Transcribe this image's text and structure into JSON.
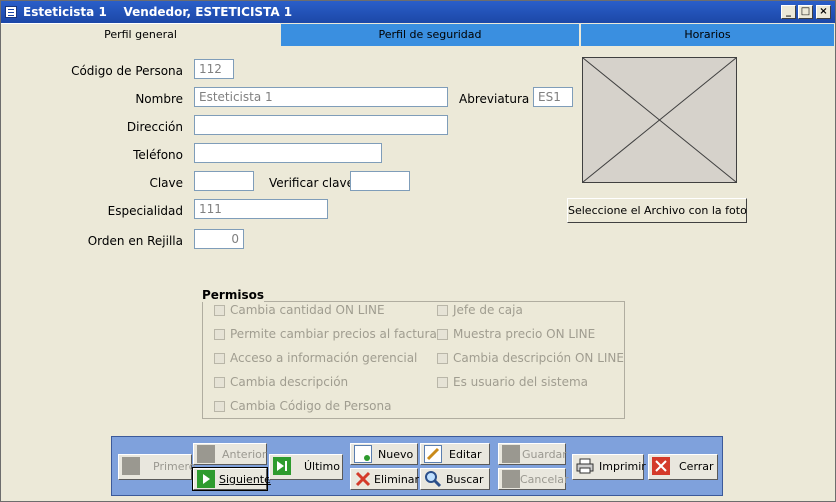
{
  "window": {
    "title": "Esteticista 1    Vendedor, ESTETICISTA 1",
    "minimize_glyph": "_",
    "restore_glyph": "□",
    "close_glyph": "×"
  },
  "tabs": [
    {
      "label": "Perfil general",
      "active": true
    },
    {
      "label": "Perfil de seguridad",
      "active": false
    },
    {
      "label": "Horarios",
      "active": false
    }
  ],
  "form": {
    "codigo_label": "Código de Persona",
    "codigo_value": "112",
    "nombre_label": "Nombre",
    "nombre_value": "Esteticista 1",
    "abreviatura_label": "Abreviatura",
    "abreviatura_value": "ES1",
    "direccion_label": "Dirección",
    "direccion_value": "",
    "telefono_label": "Teléfono",
    "telefono_value": "",
    "clave_label": "Clave",
    "clave_value": "",
    "verificar_label": "Verificar clave",
    "verificar_value": "",
    "especialidad_label": "Especialidad",
    "especialidad_value": "111",
    "orden_label": "Orden en Rejilla",
    "orden_value": "0"
  },
  "photo": {
    "button_label": "Seleccione el Archivo con la foto"
  },
  "permisos": {
    "title": "Permisos",
    "left": [
      {
        "label": "Cambia cantidad ON LINE",
        "checked": false
      },
      {
        "label": "Permite cambiar precios al facturar",
        "checked": false
      },
      {
        "label": "Acceso a información gerencial",
        "checked": false
      },
      {
        "label": "Cambia descripción",
        "checked": false
      },
      {
        "label": "Cambia Código de Persona",
        "checked": false
      }
    ],
    "right": [
      {
        "label": "Jefe de caja",
        "checked": false
      },
      {
        "label": "Muestra precio ON LINE",
        "checked": false
      },
      {
        "label": "Cambia descripción ON LINE",
        "checked": false
      },
      {
        "label": "Es usuario del sistema",
        "checked": false
      }
    ]
  },
  "toolbar": {
    "primero": "Primero",
    "anterior": "Anterior",
    "siguiente": "Siguiente",
    "ultimo": "Último",
    "nuevo": "Nuevo",
    "editar": "Editar",
    "eliminar": "Eliminar",
    "buscar": "Buscar",
    "guardar": "Guardar",
    "cancelar": "Cancelar",
    "imprimir": "Imprimir",
    "cerrar": "Cerrar"
  },
  "colors": {
    "title_bar": "#1c47a7",
    "tab_inactive": "#3a8fe0",
    "toolbar_bg": "#7fa1dc",
    "nav_green": "#2e9b2e",
    "delete_red": "#d43a2a"
  }
}
